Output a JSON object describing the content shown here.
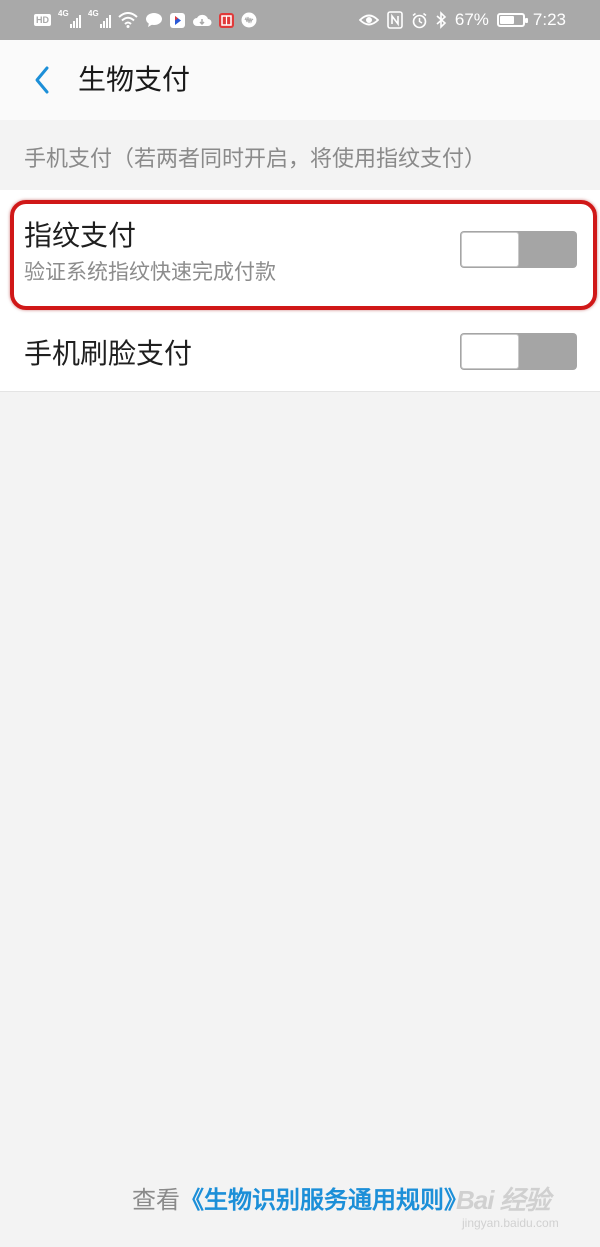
{
  "status_bar": {
    "hd_label": "HD",
    "net_1": "4G",
    "net_2": "4G",
    "battery_percent": "67%",
    "battery_level": 0.67,
    "time": "7:23",
    "left_icons": [
      "hd-badge-icon",
      "signal-icon",
      "signal-icon",
      "wifi-icon",
      "chat-bubble-icon",
      "video-app-icon",
      "cloud-icon",
      "reader-app-icon",
      "audio-app-icon"
    ],
    "right_icons": [
      "eye-icon",
      "nfc-icon",
      "alarm-icon",
      "bluetooth-icon",
      "battery-icon"
    ]
  },
  "header": {
    "back_icon": "chevron-left-icon",
    "title": "生物支付"
  },
  "section": {
    "label": "手机支付（若两者同时开启，将使用指纹支付）"
  },
  "settings": [
    {
      "title": "指纹支付",
      "subtitle": "验证系统指纹快速完成付款",
      "enabled": false
    },
    {
      "title": "手机刷脸支付",
      "enabled": false
    }
  ],
  "footer": {
    "prefix": "查看",
    "link": "《生物识别服务通用规则》"
  },
  "watermark": {
    "main": "Bai 经验",
    "sub": "jingyan.baidu.com"
  },
  "colors": {
    "accent": "#1c8fd8",
    "status_bar_bg": "#a9a9a9",
    "page_bg": "#f3f3f3",
    "toggle_off": "#a5a5a5",
    "highlight": "#d01818"
  }
}
